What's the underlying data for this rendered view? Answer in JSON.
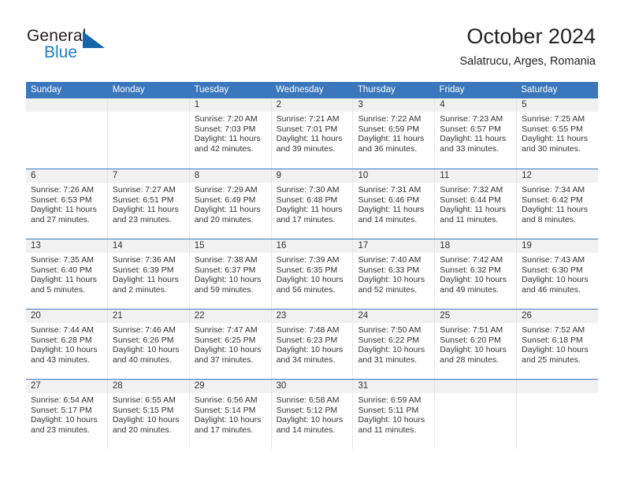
{
  "brand": {
    "name_top": "General",
    "name_bottom": "Blue",
    "triangle_icon": "triangle-icon",
    "color_dark": "#231f20",
    "color_blue": "#1e7fc4",
    "color_triangle": "#1565a8"
  },
  "header": {
    "title": "October 2024",
    "subtitle": "Salatrucu, Arges, Romania"
  },
  "theme": {
    "header_blue": "#3b77bc",
    "daynum_band": "#f1f1f1",
    "cell_divider": "#e6e6e6",
    "text": "#333333"
  },
  "weekday_headers": [
    "Sunday",
    "Monday",
    "Tuesday",
    "Wednesday",
    "Thursday",
    "Friday",
    "Saturday"
  ],
  "weeks": [
    [
      {
        "day": "",
        "sunrise": "",
        "sunset": "",
        "daylight": ""
      },
      {
        "day": "",
        "sunrise": "",
        "sunset": "",
        "daylight": ""
      },
      {
        "day": "1",
        "sunrise": "Sunrise: 7:20 AM",
        "sunset": "Sunset: 7:03 PM",
        "daylight": "Daylight: 11 hours and 42 minutes."
      },
      {
        "day": "2",
        "sunrise": "Sunrise: 7:21 AM",
        "sunset": "Sunset: 7:01 PM",
        "daylight": "Daylight: 11 hours and 39 minutes."
      },
      {
        "day": "3",
        "sunrise": "Sunrise: 7:22 AM",
        "sunset": "Sunset: 6:59 PM",
        "daylight": "Daylight: 11 hours and 36 minutes."
      },
      {
        "day": "4",
        "sunrise": "Sunrise: 7:23 AM",
        "sunset": "Sunset: 6:57 PM",
        "daylight": "Daylight: 11 hours and 33 minutes."
      },
      {
        "day": "5",
        "sunrise": "Sunrise: 7:25 AM",
        "sunset": "Sunset: 6:55 PM",
        "daylight": "Daylight: 11 hours and 30 minutes."
      }
    ],
    [
      {
        "day": "6",
        "sunrise": "Sunrise: 7:26 AM",
        "sunset": "Sunset: 6:53 PM",
        "daylight": "Daylight: 11 hours and 27 minutes."
      },
      {
        "day": "7",
        "sunrise": "Sunrise: 7:27 AM",
        "sunset": "Sunset: 6:51 PM",
        "daylight": "Daylight: 11 hours and 23 minutes."
      },
      {
        "day": "8",
        "sunrise": "Sunrise: 7:29 AM",
        "sunset": "Sunset: 6:49 PM",
        "daylight": "Daylight: 11 hours and 20 minutes."
      },
      {
        "day": "9",
        "sunrise": "Sunrise: 7:30 AM",
        "sunset": "Sunset: 6:48 PM",
        "daylight": "Daylight: 11 hours and 17 minutes."
      },
      {
        "day": "10",
        "sunrise": "Sunrise: 7:31 AM",
        "sunset": "Sunset: 6:46 PM",
        "daylight": "Daylight: 11 hours and 14 minutes."
      },
      {
        "day": "11",
        "sunrise": "Sunrise: 7:32 AM",
        "sunset": "Sunset: 6:44 PM",
        "daylight": "Daylight: 11 hours and 11 minutes."
      },
      {
        "day": "12",
        "sunrise": "Sunrise: 7:34 AM",
        "sunset": "Sunset: 6:42 PM",
        "daylight": "Daylight: 11 hours and 8 minutes."
      }
    ],
    [
      {
        "day": "13",
        "sunrise": "Sunrise: 7:35 AM",
        "sunset": "Sunset: 6:40 PM",
        "daylight": "Daylight: 11 hours and 5 minutes."
      },
      {
        "day": "14",
        "sunrise": "Sunrise: 7:36 AM",
        "sunset": "Sunset: 6:39 PM",
        "daylight": "Daylight: 11 hours and 2 minutes."
      },
      {
        "day": "15",
        "sunrise": "Sunrise: 7:38 AM",
        "sunset": "Sunset: 6:37 PM",
        "daylight": "Daylight: 10 hours and 59 minutes."
      },
      {
        "day": "16",
        "sunrise": "Sunrise: 7:39 AM",
        "sunset": "Sunset: 6:35 PM",
        "daylight": "Daylight: 10 hours and 56 minutes."
      },
      {
        "day": "17",
        "sunrise": "Sunrise: 7:40 AM",
        "sunset": "Sunset: 6:33 PM",
        "daylight": "Daylight: 10 hours and 52 minutes."
      },
      {
        "day": "18",
        "sunrise": "Sunrise: 7:42 AM",
        "sunset": "Sunset: 6:32 PM",
        "daylight": "Daylight: 10 hours and 49 minutes."
      },
      {
        "day": "19",
        "sunrise": "Sunrise: 7:43 AM",
        "sunset": "Sunset: 6:30 PM",
        "daylight": "Daylight: 10 hours and 46 minutes."
      }
    ],
    [
      {
        "day": "20",
        "sunrise": "Sunrise: 7:44 AM",
        "sunset": "Sunset: 6:28 PM",
        "daylight": "Daylight: 10 hours and 43 minutes."
      },
      {
        "day": "21",
        "sunrise": "Sunrise: 7:46 AM",
        "sunset": "Sunset: 6:26 PM",
        "daylight": "Daylight: 10 hours and 40 minutes."
      },
      {
        "day": "22",
        "sunrise": "Sunrise: 7:47 AM",
        "sunset": "Sunset: 6:25 PM",
        "daylight": "Daylight: 10 hours and 37 minutes."
      },
      {
        "day": "23",
        "sunrise": "Sunrise: 7:48 AM",
        "sunset": "Sunset: 6:23 PM",
        "daylight": "Daylight: 10 hours and 34 minutes."
      },
      {
        "day": "24",
        "sunrise": "Sunrise: 7:50 AM",
        "sunset": "Sunset: 6:22 PM",
        "daylight": "Daylight: 10 hours and 31 minutes."
      },
      {
        "day": "25",
        "sunrise": "Sunrise: 7:51 AM",
        "sunset": "Sunset: 6:20 PM",
        "daylight": "Daylight: 10 hours and 28 minutes."
      },
      {
        "day": "26",
        "sunrise": "Sunrise: 7:52 AM",
        "sunset": "Sunset: 6:18 PM",
        "daylight": "Daylight: 10 hours and 25 minutes."
      }
    ],
    [
      {
        "day": "27",
        "sunrise": "Sunrise: 6:54 AM",
        "sunset": "Sunset: 5:17 PM",
        "daylight": "Daylight: 10 hours and 23 minutes."
      },
      {
        "day": "28",
        "sunrise": "Sunrise: 6:55 AM",
        "sunset": "Sunset: 5:15 PM",
        "daylight": "Daylight: 10 hours and 20 minutes."
      },
      {
        "day": "29",
        "sunrise": "Sunrise: 6:56 AM",
        "sunset": "Sunset: 5:14 PM",
        "daylight": "Daylight: 10 hours and 17 minutes."
      },
      {
        "day": "30",
        "sunrise": "Sunrise: 6:58 AM",
        "sunset": "Sunset: 5:12 PM",
        "daylight": "Daylight: 10 hours and 14 minutes."
      },
      {
        "day": "31",
        "sunrise": "Sunrise: 6:59 AM",
        "sunset": "Sunset: 5:11 PM",
        "daylight": "Daylight: 10 hours and 11 minutes."
      },
      {
        "day": "",
        "sunrise": "",
        "sunset": "",
        "daylight": ""
      },
      {
        "day": "",
        "sunrise": "",
        "sunset": "",
        "daylight": ""
      }
    ]
  ]
}
